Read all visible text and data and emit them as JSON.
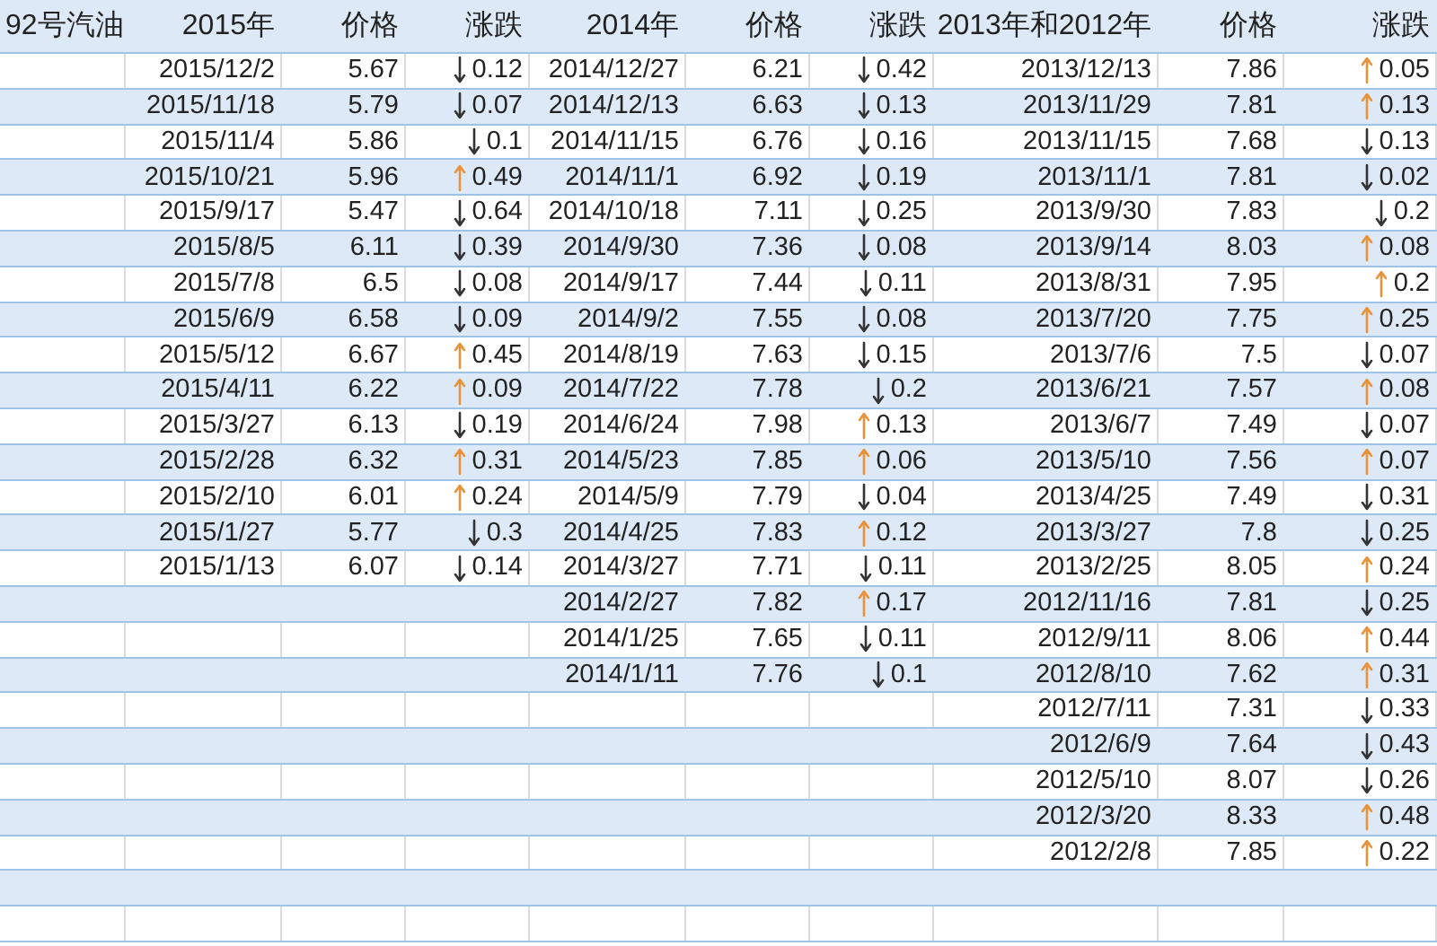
{
  "table": {
    "corner_header": "92号汽油",
    "sections": [
      {
        "title": "2015年",
        "price_header": "价格",
        "change_header": "涨跌",
        "entries": [
          {
            "date": "2015/12/2",
            "price": "5.67",
            "rising": false,
            "change": "0.12"
          },
          {
            "date": "2015/11/18",
            "price": "5.79",
            "rising": false,
            "change": "0.07"
          },
          {
            "date": "2015/11/4",
            "price": "5.86",
            "rising": false,
            "change": "0.1"
          },
          {
            "date": "2015/10/21",
            "price": "5.96",
            "rising": true,
            "change": "0.49"
          },
          {
            "date": "2015/9/17",
            "price": "5.47",
            "rising": false,
            "change": "0.64"
          },
          {
            "date": "2015/8/5",
            "price": "6.11",
            "rising": false,
            "change": "0.39"
          },
          {
            "date": "2015/7/8",
            "price": "6.5",
            "rising": false,
            "change": "0.08"
          },
          {
            "date": "2015/6/9",
            "price": "6.58",
            "rising": false,
            "change": "0.09"
          },
          {
            "date": "2015/5/12",
            "price": "6.67",
            "rising": true,
            "change": "0.45"
          },
          {
            "date": "2015/4/11",
            "price": "6.22",
            "rising": true,
            "change": "0.09"
          },
          {
            "date": "2015/3/27",
            "price": "6.13",
            "rising": false,
            "change": "0.19"
          },
          {
            "date": "2015/2/28",
            "price": "6.32",
            "rising": true,
            "change": "0.31"
          },
          {
            "date": "2015/2/10",
            "price": "6.01",
            "rising": true,
            "change": "0.24"
          },
          {
            "date": "2015/1/27",
            "price": "5.77",
            "rising": false,
            "change": "0.3"
          },
          {
            "date": "2015/1/13",
            "price": "6.07",
            "rising": false,
            "change": "0.14"
          }
        ]
      },
      {
        "title": "2014年",
        "price_header": "价格",
        "change_header": "涨跌",
        "entries": [
          {
            "date": "2014/12/27",
            "price": "6.21",
            "rising": false,
            "change": "0.42"
          },
          {
            "date": "2014/12/13",
            "price": "6.63",
            "rising": false,
            "change": "0.13"
          },
          {
            "date": "2014/11/15",
            "price": "6.76",
            "rising": false,
            "change": "0.16"
          },
          {
            "date": "2014/11/1",
            "price": "6.92",
            "rising": false,
            "change": "0.19"
          },
          {
            "date": "2014/10/18",
            "price": "7.11",
            "rising": false,
            "change": "0.25"
          },
          {
            "date": "2014/9/30",
            "price": "7.36",
            "rising": false,
            "change": "0.08"
          },
          {
            "date": "2014/9/17",
            "price": "7.44",
            "rising": false,
            "change": "0.11"
          },
          {
            "date": "2014/9/2",
            "price": "7.55",
            "rising": false,
            "change": "0.08"
          },
          {
            "date": "2014/8/19",
            "price": "7.63",
            "rising": false,
            "change": "0.15"
          },
          {
            "date": "2014/7/22",
            "price": "7.78",
            "rising": false,
            "change": "0.2"
          },
          {
            "date": "2014/6/24",
            "price": "7.98",
            "rising": true,
            "change": "0.13"
          },
          {
            "date": "2014/5/23",
            "price": "7.85",
            "rising": true,
            "change": "0.06"
          },
          {
            "date": "2014/5/9",
            "price": "7.79",
            "rising": false,
            "change": "0.04"
          },
          {
            "date": "2014/4/25",
            "price": "7.83",
            "rising": true,
            "change": "0.12"
          },
          {
            "date": "2014/3/27",
            "price": "7.71",
            "rising": false,
            "change": "0.11"
          },
          {
            "date": "2014/2/27",
            "price": "7.82",
            "rising": true,
            "change": "0.17"
          },
          {
            "date": "2014/1/25",
            "price": "7.65",
            "rising": false,
            "change": "0.11"
          },
          {
            "date": "2014/1/11",
            "price": "7.76",
            "rising": false,
            "change": "0.1"
          }
        ]
      },
      {
        "title": "2013年和2012年",
        "price_header": "价格",
        "change_header": "涨跌",
        "entries": [
          {
            "date": "2013/12/13",
            "price": "7.86",
            "rising": true,
            "change": "0.05"
          },
          {
            "date": "2013/11/29",
            "price": "7.81",
            "rising": true,
            "change": "0.13"
          },
          {
            "date": "2013/11/15",
            "price": "7.68",
            "rising": false,
            "change": "0.13"
          },
          {
            "date": "2013/11/1",
            "price": "7.81",
            "rising": false,
            "change": "0.02"
          },
          {
            "date": "2013/9/30",
            "price": "7.83",
            "rising": false,
            "change": "0.2"
          },
          {
            "date": "2013/9/14",
            "price": "8.03",
            "rising": true,
            "change": "0.08"
          },
          {
            "date": "2013/8/31",
            "price": "7.95",
            "rising": true,
            "change": "0.2"
          },
          {
            "date": "2013/7/20",
            "price": "7.75",
            "rising": true,
            "change": "0.25"
          },
          {
            "date": "2013/7/6",
            "price": "7.5",
            "rising": false,
            "change": "0.07"
          },
          {
            "date": "2013/6/21",
            "price": "7.57",
            "rising": true,
            "change": "0.08"
          },
          {
            "date": "2013/6/7",
            "price": "7.49",
            "rising": false,
            "change": "0.07"
          },
          {
            "date": "2013/5/10",
            "price": "7.56",
            "rising": true,
            "change": "0.07"
          },
          {
            "date": "2013/4/25",
            "price": "7.49",
            "rising": false,
            "change": "0.31"
          },
          {
            "date": "2013/3/27",
            "price": "7.8",
            "rising": false,
            "change": "0.25"
          },
          {
            "date": "2013/2/25",
            "price": "8.05",
            "rising": true,
            "change": "0.24"
          },
          {
            "date": "2012/11/16",
            "price": "7.81",
            "rising": false,
            "change": "0.25"
          },
          {
            "date": "2012/9/11",
            "price": "8.06",
            "rising": true,
            "change": "0.44"
          },
          {
            "date": "2012/8/10",
            "price": "7.62",
            "rising": true,
            "change": "0.31"
          },
          {
            "date": "2012/7/11",
            "price": "7.31",
            "rising": false,
            "change": "0.33"
          },
          {
            "date": "2012/6/9",
            "price": "7.64",
            "rising": false,
            "change": "0.43"
          },
          {
            "date": "2012/5/10",
            "price": "8.07",
            "rising": false,
            "change": "0.26"
          },
          {
            "date": "2012/3/20",
            "price": "8.33",
            "rising": true,
            "change": "0.48"
          },
          {
            "date": "2012/2/8",
            "price": "7.85",
            "rising": true,
            "change": "0.22"
          }
        ]
      }
    ]
  }
}
